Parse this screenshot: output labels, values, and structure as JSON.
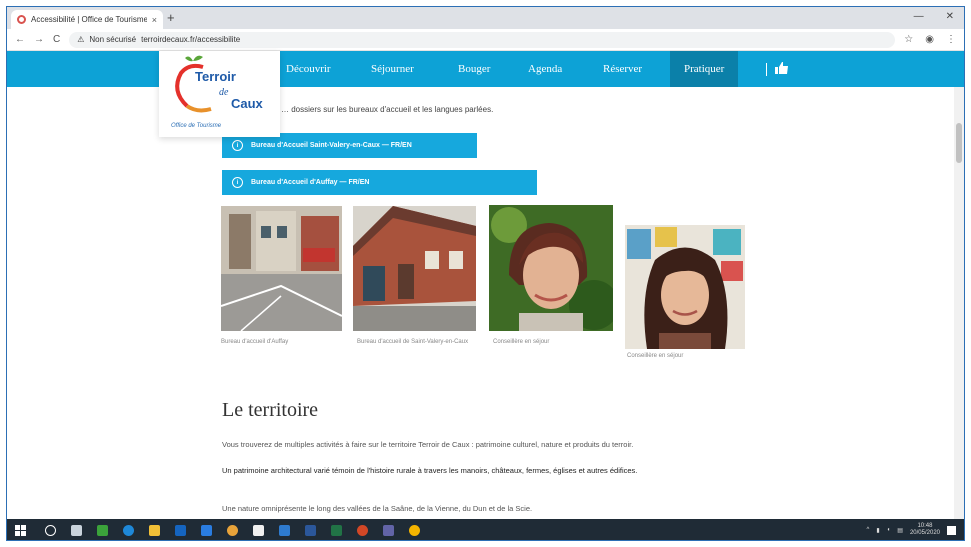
{
  "browser": {
    "tab_title": "Accessibilité | Office de Tourisme",
    "tab_close": "×",
    "new_tab": "+",
    "window_controls": [
      "—",
      "✕"
    ],
    "nav_back": "←",
    "nav_forward": "→",
    "reload": "C",
    "url_prefix": "Non sécurisé",
    "url": "terroirdecaux.fr/accessibilite",
    "star": "☆",
    "menu": "⋮"
  },
  "logo": {
    "line1": "Terroir",
    "line2": "de",
    "line3": "Caux",
    "tagline": "Office de Tourisme"
  },
  "nav": {
    "items": [
      "Découvrir",
      "Séjourner",
      "Bouger",
      "Agenda",
      "Réserver",
      "Pratiquer"
    ],
    "active_index": 5
  },
  "main": {
    "intro": "… dossiers sur les bureaux d'accueil et les langues parlées.",
    "buttons": [
      "Bureau d'Accueil Saint-Valery-en-Caux — FR/EN",
      "Bureau d'Accueil d'Auffay — FR/EN"
    ],
    "captions": [
      "Bureau d'accueil d'Auffay",
      "Bureau d'accueil de Saint-Valery-en-Caux",
      "Conseillère en séjour",
      "Conseillère en séjour"
    ],
    "heading": "Le territoire",
    "para1": "Vous trouverez de multiples activités à faire sur le territoire Terroir de Caux : patrimoine culturel, nature et produits du terroir.",
    "para2a": "Un patrimoine architectural varié témoin de l'histoire rurale à travers les manoirs, châteaux, fermes, églises et autres édifices.",
    "para3": "Une nature omniprésente le long des vallées de la Saâne, de la Vienne, du Dun et de la Scie."
  },
  "colors": {
    "nav_bg": "#0da2d6",
    "nav_active": "#0b80a9",
    "button_bg": "#16a8dd",
    "taskbar": "#1f2b36"
  },
  "taskbar": {
    "clock_time": "10:48",
    "clock_date": "20/05/2020",
    "tray_icons": [
      "chevron-up-icon",
      "network-icon",
      "volume-icon",
      "language-icon"
    ]
  }
}
